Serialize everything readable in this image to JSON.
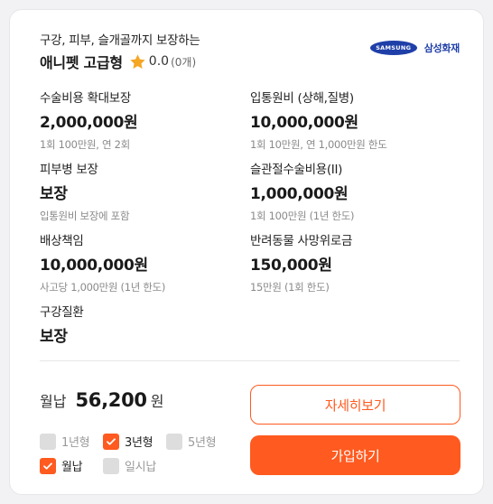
{
  "product": {
    "subtitle": "구강, 피부, 슬개골까지 보장하는",
    "name": "애니펫 고급형",
    "rating": "0.0",
    "review_count": "0개",
    "star_icon": "star-icon",
    "star_color": "#f5a623"
  },
  "insurer": {
    "logo_text": "SAMSUNG",
    "name": "삼성화재",
    "color": "#1f3fa8"
  },
  "coverages": [
    {
      "label": "수술비용 확대보장",
      "value": "2,000,000원",
      "note": "1회 100만원, 연 2회"
    },
    {
      "label": "입통원비 (상해,질병)",
      "value": "10,000,000원",
      "note": "1회 10만원, 연 1,000만원 한도"
    },
    {
      "label": "피부병 보장",
      "value": "보장",
      "note": "입통원비 보장에 포함"
    },
    {
      "label": "슬관절수술비용(II)",
      "value": "1,000,000원",
      "note": "1회 100만원 (1년 한도)"
    },
    {
      "label": "배상책임",
      "value": "10,000,000원",
      "note": "사고당 1,000만원 (1년 한도)"
    },
    {
      "label": "반려동물 사망위로금",
      "value": "150,000원",
      "note": "15만원 (1회 한도)"
    },
    {
      "label": "구강질환",
      "value": "보장",
      "note": ""
    }
  ],
  "premium": {
    "label": "월납",
    "amount": "56,200",
    "unit": "원"
  },
  "options": [
    {
      "label": "1년형",
      "checked": false
    },
    {
      "label": "3년형",
      "checked": true
    },
    {
      "label": "5년형",
      "checked": false
    },
    {
      "label": "월납",
      "checked": true
    },
    {
      "label": "일시납",
      "checked": false
    }
  ],
  "buttons": {
    "detail": "자세히보기",
    "join": "가입하기"
  },
  "colors": {
    "accent": "#ff5a1f",
    "unchecked": "#dddddd"
  }
}
